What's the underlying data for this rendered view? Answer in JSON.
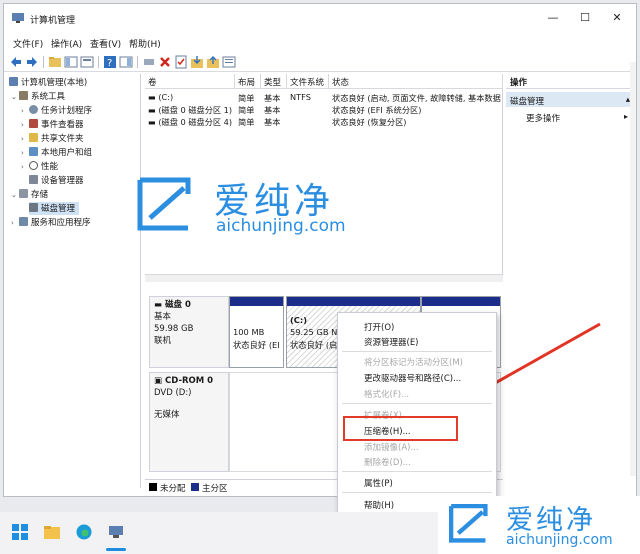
{
  "window": {
    "title": "计算机管理",
    "controls": {
      "minimize": "—",
      "maximize": "☐",
      "close": "✕"
    }
  },
  "menu": [
    "文件(F)",
    "操作(A)",
    "查看(V)",
    "帮助(H)"
  ],
  "tree": {
    "root": "计算机管理(本地)",
    "system_tools": "系统工具",
    "task_scheduler": "任务计划程序",
    "event_viewer": "事件查看器",
    "shared_folders": "共享文件夹",
    "local_users": "本地用户和组",
    "performance": "性能",
    "device_manager": "设备管理器",
    "storage": "存储",
    "disk_management": "磁盘管理",
    "services_apps": "服务和应用程序"
  },
  "volume_table": {
    "headers": [
      "卷",
      "布局",
      "类型",
      "文件系统",
      "状态"
    ],
    "rows": [
      [
        "(C:)",
        "简单",
        "基本",
        "NTFS",
        "状态良好 (启动, 页面文件, 故障转储, 基本数据"
      ],
      [
        "(磁盘 0 磁盘分区 1)",
        "简单",
        "基本",
        "",
        "状态良好 (EFI 系统分区)"
      ],
      [
        "(磁盘 0 磁盘分区 4)",
        "简单",
        "基本",
        "",
        "状态良好 (恢复分区)"
      ]
    ]
  },
  "disks": {
    "disk0": {
      "name": "磁盘 0",
      "type": "基本",
      "size": "59.98 GB",
      "status": "联机",
      "partitions": [
        {
          "size": "100 MB",
          "status": "状态良好 (EI"
        },
        {
          "name": "(C:)",
          "size": "59.25 GB NT",
          "status": "状态良好 (启"
        }
      ]
    },
    "cdrom": {
      "name": "CD-ROM 0",
      "type": "DVD (D:)",
      "media": "无媒体"
    }
  },
  "legend": {
    "unallocated": "未分配",
    "primary": "主分区"
  },
  "actions": {
    "header": "操作",
    "section": "磁盘管理",
    "more": "更多操作"
  },
  "context_menu": [
    {
      "label": "打开(O)",
      "enabled": true
    },
    {
      "label": "资源管理器(E)",
      "enabled": true
    },
    {
      "label": "将分区标记为活动分区(M)",
      "enabled": false
    },
    {
      "label": "更改驱动器号和路径(C)...",
      "enabled": true
    },
    {
      "label": "格式化(F)...",
      "enabled": false
    },
    {
      "label": "扩展卷(X)...",
      "enabled": false
    },
    {
      "label": "压缩卷(H)...",
      "enabled": true
    },
    {
      "label": "添加镜像(A)...",
      "enabled": false
    },
    {
      "label": "删除卷(D)...",
      "enabled": false
    },
    {
      "label": "属性(P)",
      "enabled": true
    },
    {
      "label": "帮助(H)",
      "enabled": true
    }
  ],
  "watermark": {
    "brand": "爱纯净",
    "url": "aichunjing.com"
  },
  "colors": {
    "partition_bar": "#1c2d8a",
    "highlight": "#e23b2a",
    "arrow": "#e03424",
    "selection": "#cfe2f5",
    "watermark": "#2b8ee0"
  }
}
